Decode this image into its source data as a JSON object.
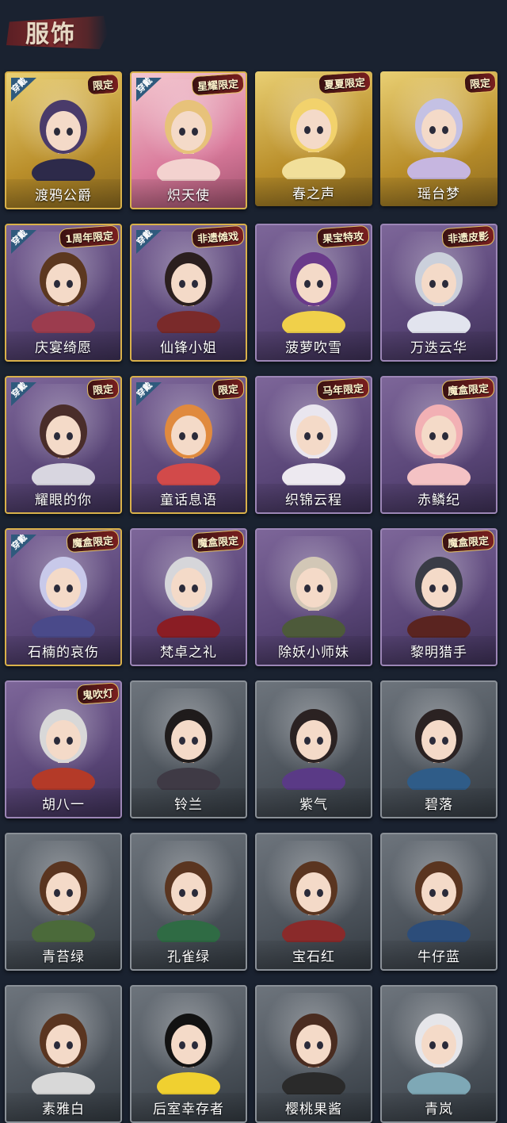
{
  "section": {
    "title": "服饰"
  },
  "costumes": [
    {
      "name": "渡鸦公爵",
      "badge": "限定",
      "equipped": true,
      "style": "gold",
      "hair": "#4a3b6a",
      "outfit": "#2d2a4a"
    },
    {
      "name": "炽天使",
      "badge": "星耀限定",
      "equipped": true,
      "style": "pink",
      "hair": "#e7c27a",
      "outfit": "#f3d2cf"
    },
    {
      "name": "春之声",
      "badge": "夏夏限定",
      "equipped": false,
      "style": "gold",
      "hair": "#f2d26c",
      "outfit": "#f1df9a"
    },
    {
      "name": "瑶台梦",
      "badge": "限定",
      "equipped": false,
      "style": "gold",
      "hair": "#c4c1e4",
      "outfit": "#c6b6e0"
    },
    {
      "name": "庆宴绮愿",
      "badge": "1周年限定",
      "equipped": true,
      "style": "purple",
      "hair": "#5c3820",
      "outfit": "#9c3c4e"
    },
    {
      "name": "仙锋小姐",
      "badge": "非遗傩戏",
      "equipped": true,
      "style": "purple",
      "hair": "#2b1f1e",
      "outfit": "#7a2a2a"
    },
    {
      "name": "菠萝吹雪",
      "badge": "果宝特攻",
      "equipped": false,
      "style": "purple",
      "hair": "#6a3a8a",
      "outfit": "#f0d04a"
    },
    {
      "name": "万迭云华",
      "badge": "非遗皮影",
      "equipped": false,
      "style": "purple",
      "hair": "#cbd0db",
      "outfit": "#e2e4ee"
    },
    {
      "name": "耀眼的你",
      "badge": "限定",
      "equipped": true,
      "style": "purple",
      "hair": "#4a2d2a",
      "outfit": "#d8d6e0"
    },
    {
      "name": "童话息语",
      "badge": "限定",
      "equipped": true,
      "style": "purple",
      "hair": "#e08a3e",
      "outfit": "#d24a4a"
    },
    {
      "name": "织锦云程",
      "badge": "马年限定",
      "equipped": false,
      "style": "purple",
      "hair": "#e9e6ef",
      "outfit": "#ede9f0"
    },
    {
      "name": "赤鳞纪",
      "badge": "魔盒限定",
      "equipped": false,
      "style": "purple",
      "hair": "#f2b0b4",
      "outfit": "#f4c2c4"
    },
    {
      "name": "石楠的哀伤",
      "badge": "魔盒限定",
      "equipped": true,
      "style": "purple",
      "hair": "#c8c9ea",
      "outfit": "#4a4a8a"
    },
    {
      "name": "梵卓之礼",
      "badge": "魔盒限定",
      "equipped": false,
      "style": "purple",
      "hair": "#d6d6da",
      "outfit": "#8a1d24"
    },
    {
      "name": "除妖小师妹",
      "badge": "",
      "equipped": false,
      "style": "purple",
      "hair": "#d2c7b6",
      "outfit": "#4d5a3a"
    },
    {
      "name": "黎明猎手",
      "badge": "魔盒限定",
      "equipped": false,
      "style": "purple",
      "hair": "#3a3c46",
      "outfit": "#5a2420"
    },
    {
      "name": "胡八一",
      "badge": "鬼吹灯",
      "equipped": false,
      "style": "purple",
      "hair": "#d8d8d8",
      "outfit": "#b43a28"
    },
    {
      "name": "铃兰",
      "badge": "",
      "equipped": false,
      "style": "gray",
      "hair": "#1f1b1b",
      "outfit": "#3f3a45"
    },
    {
      "name": "紫气",
      "badge": "",
      "equipped": false,
      "style": "gray",
      "hair": "#2b2222",
      "outfit": "#5a3a86"
    },
    {
      "name": "碧落",
      "badge": "",
      "equipped": false,
      "style": "gray",
      "hair": "#2b2222",
      "outfit": "#2f5c88"
    },
    {
      "name": "青苔绿",
      "badge": "",
      "equipped": false,
      "style": "gray",
      "hair": "#5a3520",
      "outfit": "#4b6a3a"
    },
    {
      "name": "孔雀绿",
      "badge": "",
      "equipped": false,
      "style": "gray",
      "hair": "#5a3520",
      "outfit": "#2f6b44"
    },
    {
      "name": "宝石红",
      "badge": "",
      "equipped": false,
      "style": "gray",
      "hair": "#5a3520",
      "outfit": "#8a2a2a"
    },
    {
      "name": "牛仔蓝",
      "badge": "",
      "equipped": false,
      "style": "gray",
      "hair": "#5a3520",
      "outfit": "#2c4d7a"
    },
    {
      "name": "素雅白",
      "badge": "",
      "equipped": false,
      "style": "gray",
      "hair": "#5a3520",
      "outfit": "#d8d8d8"
    },
    {
      "name": "后室幸存者",
      "badge": "",
      "equipped": false,
      "style": "gray",
      "hair": "#121212",
      "outfit": "#f0d030"
    },
    {
      "name": "樱桃果酱",
      "badge": "",
      "equipped": false,
      "style": "gray",
      "hair": "#4a2c20",
      "outfit": "#2a2a2a"
    },
    {
      "name": "青岚",
      "badge": "",
      "equipped": false,
      "style": "gray",
      "hair": "#e6e6ea",
      "outfit": "#7ea8b6"
    }
  ],
  "labels": {
    "equipped": "穿戴"
  }
}
